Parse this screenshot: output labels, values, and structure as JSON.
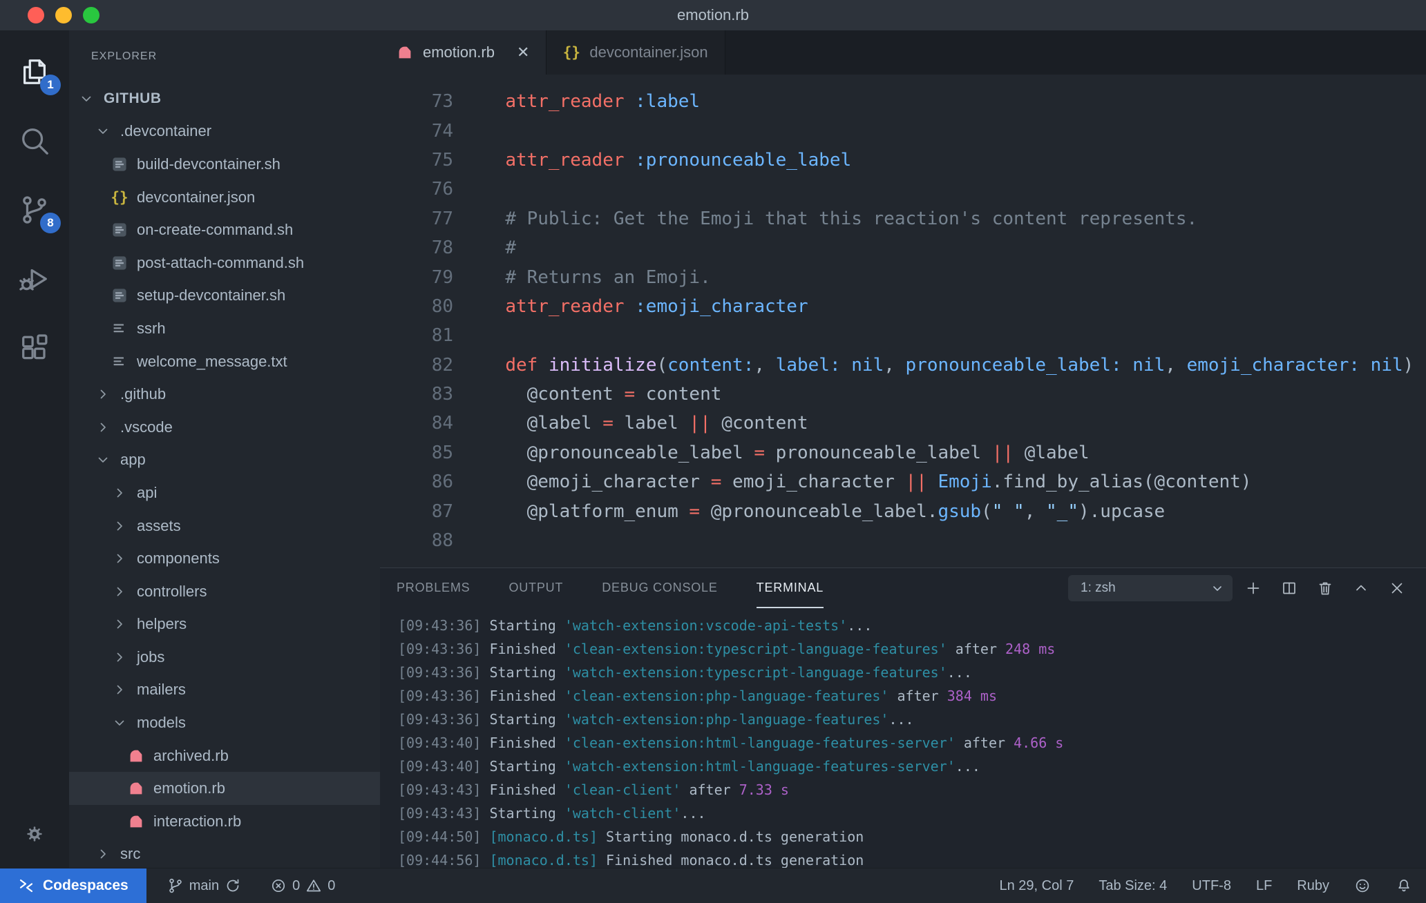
{
  "palette": {
    "accent_blue": "#316dca",
    "remote_blue": "#2d6fd6",
    "ruby_pink": "#f0808f",
    "json_yellow": "#c9b53f",
    "selection_bg": "#2d333b",
    "traffic_lights": [
      "#ff5f57",
      "#febc2e",
      "#29c73f"
    ],
    "code": [
      "#adbac7",
      "#f47067",
      "#6cb6ff",
      "#dcbdfb",
      "#768390",
      "#96d0ff"
    ],
    "terminal": {
      "g": "#768390",
      "d": "#adbac7",
      "c": "#2e8fa5",
      "m": "#ad61c9"
    }
  },
  "titlebar": {
    "title": "emotion.rb"
  },
  "activity_bar": {
    "items": [
      {
        "id": "explorer",
        "icon": "files",
        "badge": "1",
        "active": true
      },
      {
        "id": "search",
        "icon": "search"
      },
      {
        "id": "source-control",
        "icon": "source-control",
        "badge": "8"
      },
      {
        "id": "run-debug",
        "icon": "debug"
      },
      {
        "id": "extensions",
        "icon": "extensions"
      }
    ],
    "settings_icon": "gear"
  },
  "sidebar": {
    "header": "EXPLORER",
    "tree": [
      {
        "label": "GITHUB",
        "lvl": 0,
        "kind": "open",
        "root": true
      },
      {
        "label": ".devcontainer",
        "lvl": 1,
        "kind": "open"
      },
      {
        "label": "build-devcontainer.sh",
        "lvl": 2,
        "kind": "shell"
      },
      {
        "label": "devcontainer.json",
        "lvl": 2,
        "kind": "json"
      },
      {
        "label": "on-create-command.sh",
        "lvl": 2,
        "kind": "shell"
      },
      {
        "label": "post-attach-command.sh",
        "lvl": 2,
        "kind": "shell"
      },
      {
        "label": "setup-devcontainer.sh",
        "lvl": 2,
        "kind": "shell"
      },
      {
        "label": "ssrh",
        "lvl": 2,
        "kind": "text"
      },
      {
        "label": "welcome_message.txt",
        "lvl": 2,
        "kind": "text"
      },
      {
        "label": ".github",
        "lvl": 1,
        "kind": "closed"
      },
      {
        "label": ".vscode",
        "lvl": 1,
        "kind": "closed"
      },
      {
        "label": "app",
        "lvl": 1,
        "kind": "open"
      },
      {
        "label": "api",
        "lvl": 2,
        "kind": "closed"
      },
      {
        "label": "assets",
        "lvl": 2,
        "kind": "closed"
      },
      {
        "label": "components",
        "lvl": 2,
        "kind": "closed"
      },
      {
        "label": "controllers",
        "lvl": 2,
        "kind": "closed"
      },
      {
        "label": "helpers",
        "lvl": 2,
        "kind": "closed"
      },
      {
        "label": "jobs",
        "lvl": 2,
        "kind": "closed"
      },
      {
        "label": "mailers",
        "lvl": 2,
        "kind": "closed"
      },
      {
        "label": "models",
        "lvl": 2,
        "kind": "open"
      },
      {
        "label": "archived.rb",
        "lvl": 3,
        "kind": "ruby"
      },
      {
        "label": "emotion.rb",
        "lvl": 3,
        "kind": "ruby",
        "selected": true
      },
      {
        "label": "interaction.rb",
        "lvl": 3,
        "kind": "ruby"
      },
      {
        "label": "src",
        "lvl": 1,
        "kind": "closed"
      }
    ]
  },
  "tabs": [
    {
      "label": "emotion.rb",
      "icon": "ruby",
      "active": true,
      "close": "✕"
    },
    {
      "label": "devcontainer.json",
      "icon": "json",
      "active": false
    }
  ],
  "editor": {
    "lines": [
      {
        "n": "73",
        "seg": [
          [
            "  ",
            0
          ],
          [
            "attr_reader",
            1
          ],
          [
            " ",
            0
          ],
          [
            ":label",
            2
          ]
        ]
      },
      {
        "n": "74",
        "seg": []
      },
      {
        "n": "75",
        "seg": [
          [
            "  ",
            0
          ],
          [
            "attr_reader",
            1
          ],
          [
            " ",
            0
          ],
          [
            ":pronounceable_label",
            2
          ]
        ]
      },
      {
        "n": "76",
        "seg": []
      },
      {
        "n": "77",
        "seg": [
          [
            "  ",
            0
          ],
          [
            "# Public: Get the Emoji that this reaction's content represents.",
            4
          ]
        ]
      },
      {
        "n": "78",
        "seg": [
          [
            "  ",
            0
          ],
          [
            "#",
            4
          ]
        ]
      },
      {
        "n": "79",
        "seg": [
          [
            "  ",
            0
          ],
          [
            "# Returns an Emoji.",
            4
          ]
        ]
      },
      {
        "n": "80",
        "seg": [
          [
            "  ",
            0
          ],
          [
            "attr_reader",
            1
          ],
          [
            " ",
            0
          ],
          [
            ":emoji_character",
            2
          ]
        ]
      },
      {
        "n": "81",
        "seg": []
      },
      {
        "n": "82",
        "seg": [
          [
            "  ",
            0
          ],
          [
            "def",
            1
          ],
          [
            " ",
            0
          ],
          [
            "initialize",
            3
          ],
          [
            "(",
            0
          ],
          [
            "content:",
            2
          ],
          [
            ", ",
            0
          ],
          [
            "label:",
            2
          ],
          [
            " ",
            0
          ],
          [
            "nil",
            2
          ],
          [
            ", ",
            0
          ],
          [
            "pronounceable_label:",
            2
          ],
          [
            " ",
            0
          ],
          [
            "nil",
            2
          ],
          [
            ", ",
            0
          ],
          [
            "emoji_character:",
            2
          ],
          [
            " ",
            0
          ],
          [
            "nil",
            2
          ],
          [
            ")",
            0
          ]
        ]
      },
      {
        "n": "83",
        "seg": [
          [
            "    @content ",
            0
          ],
          [
            "=",
            1
          ],
          [
            " content",
            0
          ]
        ]
      },
      {
        "n": "84",
        "seg": [
          [
            "    @label ",
            0
          ],
          [
            "=",
            1
          ],
          [
            " label ",
            0
          ],
          [
            "||",
            1
          ],
          [
            " @content",
            0
          ]
        ]
      },
      {
        "n": "85",
        "seg": [
          [
            "    @pronounceable_label ",
            0
          ],
          [
            "=",
            1
          ],
          [
            " pronounceable_label ",
            0
          ],
          [
            "||",
            1
          ],
          [
            " @label",
            0
          ]
        ]
      },
      {
        "n": "86",
        "seg": [
          [
            "    @emoji_character ",
            0
          ],
          [
            "=",
            1
          ],
          [
            " emoji_character ",
            0
          ],
          [
            "||",
            1
          ],
          [
            " ",
            0
          ],
          [
            "Emoji",
            2
          ],
          [
            ".find_by_alias(@content)",
            0
          ]
        ]
      },
      {
        "n": "87",
        "seg": [
          [
            "    @platform_enum ",
            0
          ],
          [
            "=",
            1
          ],
          [
            " @pronounceable_label.",
            0
          ],
          [
            "gsub",
            2
          ],
          [
            "(",
            0
          ],
          [
            "\" \"",
            5
          ],
          [
            ", ",
            0
          ],
          [
            "\"_\"",
            5
          ],
          [
            ").upcase",
            0
          ]
        ]
      },
      {
        "n": "88",
        "seg": []
      }
    ]
  },
  "panel": {
    "tabs": [
      {
        "label": "PROBLEMS",
        "active": false
      },
      {
        "label": "OUTPUT",
        "active": false
      },
      {
        "label": "DEBUG CONSOLE",
        "active": false
      },
      {
        "label": "TERMINAL",
        "active": true
      }
    ],
    "terminal_select": "1: zsh",
    "lines": [
      [
        [
          "[09:43:36]",
          "g"
        ],
        [
          " Starting ",
          "d"
        ],
        [
          "'watch-extension:vscode-api-tests'",
          "c"
        ],
        [
          "...",
          "d"
        ]
      ],
      [
        [
          "[09:43:36]",
          "g"
        ],
        [
          " Finished ",
          "d"
        ],
        [
          "'clean-extension:typescript-language-features'",
          "c"
        ],
        [
          " after ",
          "d"
        ],
        [
          "248 ms",
          "m"
        ]
      ],
      [
        [
          "[09:43:36]",
          "g"
        ],
        [
          " Starting ",
          "d"
        ],
        [
          "'watch-extension:typescript-language-features'",
          "c"
        ],
        [
          "...",
          "d"
        ]
      ],
      [
        [
          "[09:43:36]",
          "g"
        ],
        [
          " Finished ",
          "d"
        ],
        [
          "'clean-extension:php-language-features'",
          "c"
        ],
        [
          " after ",
          "d"
        ],
        [
          "384 ms",
          "m"
        ]
      ],
      [
        [
          "[09:43:36]",
          "g"
        ],
        [
          " Starting ",
          "d"
        ],
        [
          "'watch-extension:php-language-features'",
          "c"
        ],
        [
          "...",
          "d"
        ]
      ],
      [
        [
          "[09:43:40]",
          "g"
        ],
        [
          " Finished ",
          "d"
        ],
        [
          "'clean-extension:html-language-features-server'",
          "c"
        ],
        [
          " after ",
          "d"
        ],
        [
          "4.66 s",
          "m"
        ]
      ],
      [
        [
          "[09:43:40]",
          "g"
        ],
        [
          " Starting ",
          "d"
        ],
        [
          "'watch-extension:html-language-features-server'",
          "c"
        ],
        [
          "...",
          "d"
        ]
      ],
      [
        [
          "[09:43:43]",
          "g"
        ],
        [
          " Finished ",
          "d"
        ],
        [
          "'clean-client'",
          "c"
        ],
        [
          " after ",
          "d"
        ],
        [
          "7.33 s",
          "m"
        ]
      ],
      [
        [
          "[09:43:43]",
          "g"
        ],
        [
          " Starting ",
          "d"
        ],
        [
          "'watch-client'",
          "c"
        ],
        [
          "...",
          "d"
        ]
      ],
      [
        [
          "[09:44:50]",
          "g"
        ],
        [
          " ",
          "d"
        ],
        [
          "[monaco.d.ts]",
          "c"
        ],
        [
          " Starting monaco.d.ts generation",
          "d"
        ]
      ],
      [
        [
          "[09:44:56]",
          "g"
        ],
        [
          " ",
          "d"
        ],
        [
          "[monaco.d.ts]",
          "c"
        ],
        [
          " Finished monaco.d.ts generation",
          "d"
        ]
      ]
    ]
  },
  "status_bar": {
    "codespaces": "Codespaces",
    "branch": "main",
    "errors": "0",
    "warnings": "0",
    "cursor": "Ln 29, Col 7",
    "tab_size": "Tab Size: 4",
    "encoding": "UTF-8",
    "eol": "LF",
    "language": "Ruby"
  }
}
